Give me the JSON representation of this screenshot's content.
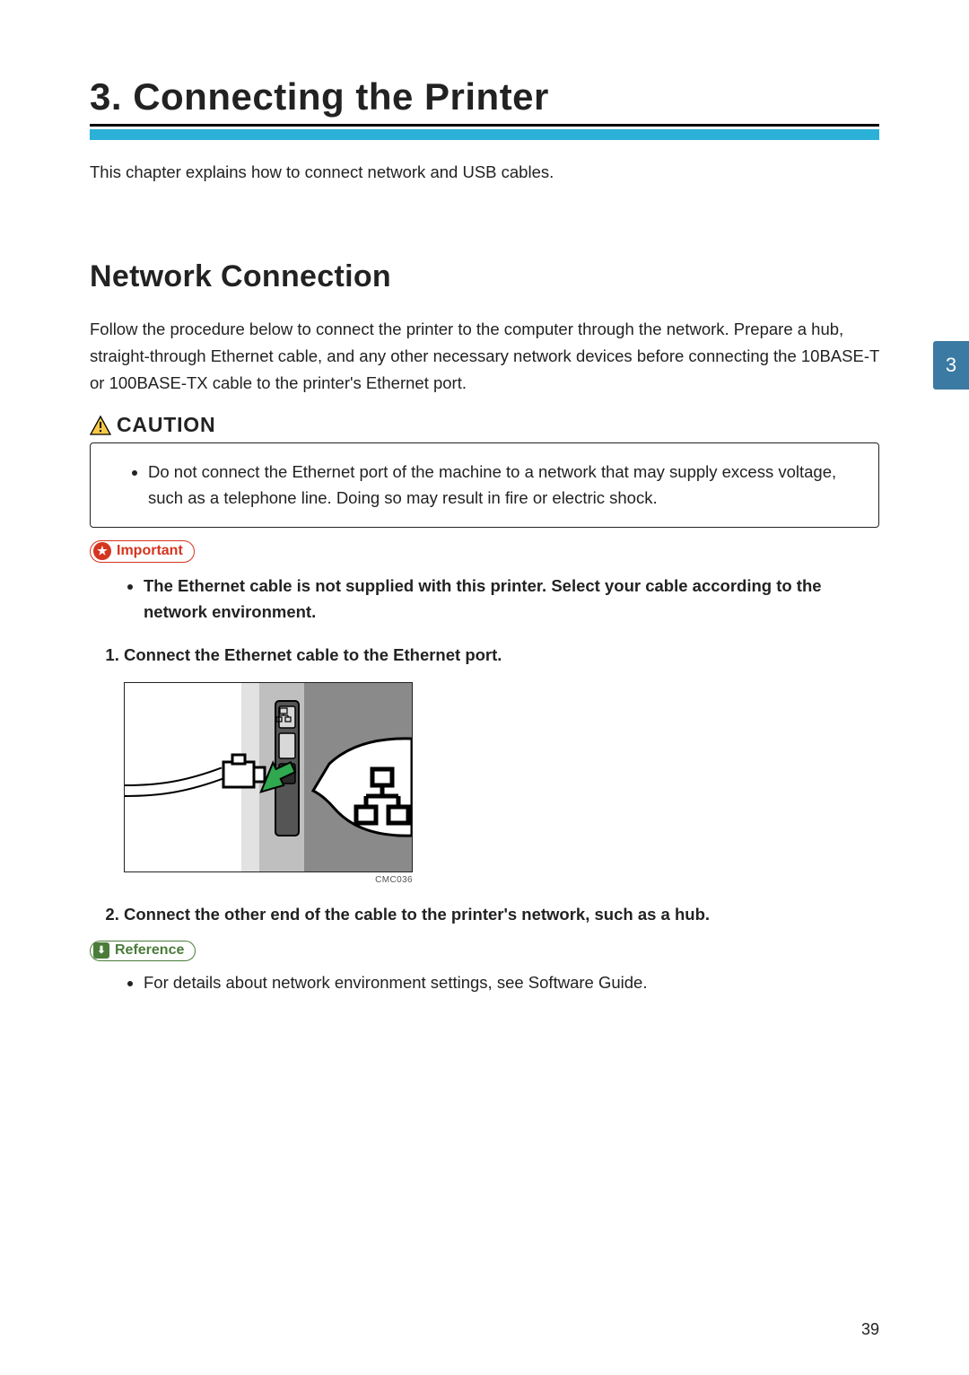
{
  "chapter": {
    "title": "3. Connecting the Printer",
    "intro": "This chapter explains how to connect network and USB cables."
  },
  "section": {
    "title": "Network Connection",
    "intro": "Follow the procedure below to connect the printer to the computer through the network. Prepare a hub, straight-through Ethernet cable, and any other necessary network devices before connecting the 10BASE-T or 100BASE-TX cable to the printer's Ethernet port."
  },
  "caution": {
    "label": "CAUTION",
    "items": [
      "Do not connect the Ethernet port of the machine to a network that may supply excess voltage, such as a telephone line. Doing so may result in fire or electric shock."
    ]
  },
  "important": {
    "label": "Important",
    "items": [
      "The Ethernet cable is not supplied with this printer. Select your cable according to the network environment."
    ]
  },
  "steps": [
    "Connect the Ethernet cable to the Ethernet port.",
    "Connect the other end of the cable to the printer's network, such as a hub."
  ],
  "figure": {
    "caption": "CMC036"
  },
  "reference": {
    "label": "Reference",
    "items": [
      "For details about network environment settings, see Software Guide."
    ]
  },
  "tab": {
    "number": "3"
  },
  "page_number": "39"
}
